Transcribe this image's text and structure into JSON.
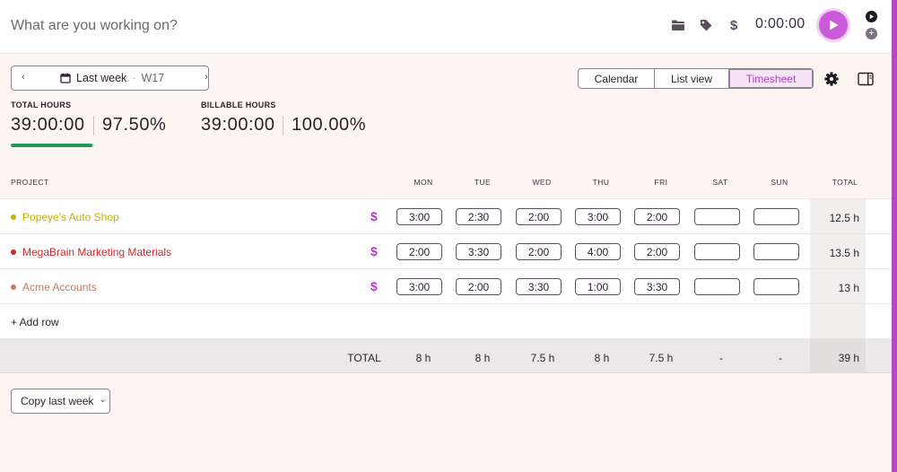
{
  "topbar": {
    "task_placeholder": "What are you working on?",
    "timer": "0:00:00",
    "icons": [
      "folder-icon",
      "tag-icon",
      "dollar-icon",
      "play-icon",
      "mini-play-icon",
      "add-icon"
    ]
  },
  "week_picker": {
    "label": "Last week",
    "separator": "·",
    "week": "W17"
  },
  "view_switch": {
    "tabs": [
      {
        "label": "Calendar",
        "active": false
      },
      {
        "label": "List view",
        "active": false
      },
      {
        "label": "Timesheet",
        "active": true
      }
    ]
  },
  "stats": {
    "total": {
      "label": "TOTAL HOURS",
      "hours": "39:00:00",
      "percent": "97.50%",
      "progress_fraction": 0.975
    },
    "billable": {
      "label": "BILLABLE HOURS",
      "hours": "39:00:00",
      "percent": "100.00%"
    }
  },
  "table": {
    "headers": {
      "project": "PROJECT",
      "days": [
        "MON",
        "TUE",
        "WED",
        "THU",
        "FRI",
        "SAT",
        "SUN"
      ],
      "total": "TOTAL"
    },
    "rows": [
      {
        "project": "Popeye's Auto Shop",
        "color": "#c2b000",
        "billable_symbol": "$",
        "hours": [
          "3:00",
          "2:30",
          "2:00",
          "3:00",
          "2:00",
          "",
          ""
        ],
        "total": "12.5 h"
      },
      {
        "project": "MegaBrain Marketing Materials",
        "color": "#d0282c",
        "billable_symbol": "$",
        "hours": [
          "2:00",
          "3:30",
          "2:00",
          "4:00",
          "2:00",
          "",
          ""
        ],
        "total": "13.5 h"
      },
      {
        "project": "Acme Accounts",
        "color": "#c97a60",
        "billable_symbol": "$",
        "hours": [
          "3:00",
          "2:00",
          "3:30",
          "1:00",
          "3:30",
          "",
          ""
        ],
        "total": "13 h"
      }
    ],
    "add_row": "+ Add row",
    "footer": {
      "label": "TOTAL",
      "days": [
        "8 h",
        "8 h",
        "7.5 h",
        "8 h",
        "7.5 h",
        "-",
        "-"
      ],
      "total": "39 h"
    }
  },
  "copy_button": {
    "label": "Copy last week",
    "chevron": "⌄"
  },
  "colors": {
    "accent": "#c95ad8",
    "progress": "#1e9a5a",
    "dollar": "#b13fbf"
  }
}
